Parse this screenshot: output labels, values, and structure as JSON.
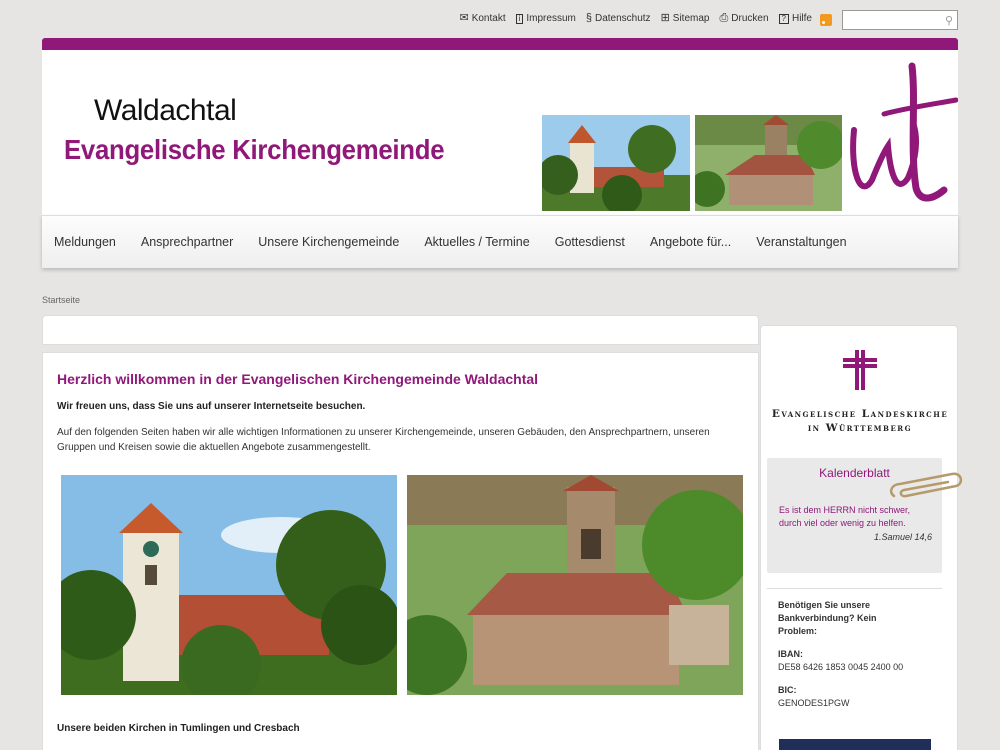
{
  "topbar": {
    "links": [
      {
        "label": "Kontakt",
        "icon": "envelope-icon"
      },
      {
        "label": "Impressum",
        "icon": "info-icon"
      },
      {
        "label": "Datenschutz",
        "icon": "paragraph-icon"
      },
      {
        "label": "Sitemap",
        "icon": "sitemap-icon"
      },
      {
        "label": "Drucken",
        "icon": "printer-icon"
      },
      {
        "label": "Hilfe",
        "icon": "help-icon"
      }
    ],
    "search_placeholder": ""
  },
  "header": {
    "title_line1": "Waldachtal",
    "title_line2": "Evangelische Kirchengemeinde"
  },
  "nav": [
    "Meldungen",
    "Ansprechpartner",
    "Unsere Kirchengemeinde",
    "Aktuelles / Termine",
    "Gottesdienst",
    "Angebote für...",
    "Veranstaltungen"
  ],
  "breadcrumb": "Startseite",
  "main": {
    "heading": "Herzlich willkommen in der Evangelischen Kirchengemeinde Waldachtal",
    "lead": "Wir freuen uns, dass Sie uns auf unserer Internetseite besuchen.",
    "body": "Auf den folgenden Seiten haben wir alle wichtigen Informationen zu unserer Kirchengemeinde, unseren Gebäuden, den Ansprechpartnern, unseren Gruppen und Kreisen sowie die aktuellen Angebote zusammengestellt.",
    "caption": "Unsere beiden Kirchen in Tumlingen und Cresbach"
  },
  "sidebar": {
    "landeskirche_line1": "Evangelische Landeskirche",
    "landeskirche_line2": "in Württemberg",
    "kalender_title": "Kalenderblatt",
    "verse": "Es ist dem HERRN nicht schwer, durch viel oder wenig zu helfen.",
    "verse_ref": "1.Samuel 14,6",
    "bank_intro": "Benötigen Sie unsere Bankverbindung? Kein Problem:",
    "iban_label": "IBAN:",
    "iban": "DE58 6426 1853 0045 2400 00",
    "bic_label": "BIC:",
    "bic": "GENODES1PGW"
  },
  "colors": {
    "accent": "#8f1879",
    "background": "#e6e5e4"
  }
}
